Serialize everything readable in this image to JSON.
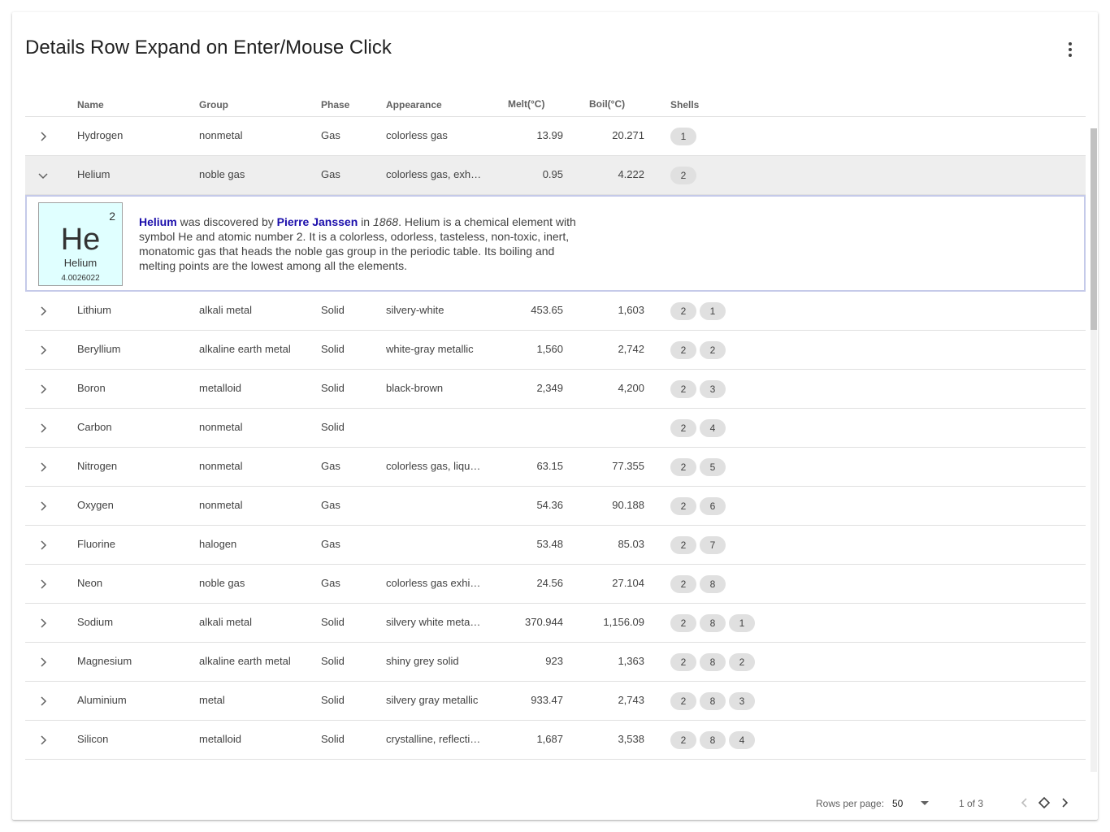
{
  "title": "Details Row Expand on Enter/Mouse Click",
  "icons": {
    "menu": "kebab-menu-icon",
    "expand": "chevron-right-icon",
    "collapse": "chevron-down-icon",
    "prev": "chevron-left-icon",
    "first": "diamond-icon",
    "next": "chevron-right-icon"
  },
  "columns": {
    "name": "Name",
    "group": "Group",
    "phase": "Phase",
    "appearance": "Appearance",
    "melt": "Melt(°C)",
    "boil": "Boil(°C)",
    "shells": "Shells"
  },
  "rows": [
    {
      "name": "Hydrogen",
      "group": "nonmetal",
      "phase": "Gas",
      "appearance": "colorless gas",
      "melt": "13.99",
      "boil": "20.271",
      "shells": [
        "1"
      ]
    },
    {
      "name": "Helium",
      "group": "noble gas",
      "phase": "Gas",
      "appearance": "colorless gas, exhi…",
      "melt": "0.95",
      "boil": "4.222",
      "shells": [
        "2"
      ],
      "expanded": true
    },
    {
      "name": "Lithium",
      "group": "alkali metal",
      "phase": "Solid",
      "appearance": "silvery-white",
      "melt": "453.65",
      "boil": "1,603",
      "shells": [
        "2",
        "1"
      ]
    },
    {
      "name": "Beryllium",
      "group": "alkaline earth metal",
      "phase": "Solid",
      "appearance": "white-gray metallic",
      "melt": "1,560",
      "boil": "2,742",
      "shells": [
        "2",
        "2"
      ]
    },
    {
      "name": "Boron",
      "group": "metalloid",
      "phase": "Solid",
      "appearance": "black-brown",
      "melt": "2,349",
      "boil": "4,200",
      "shells": [
        "2",
        "3"
      ]
    },
    {
      "name": "Carbon",
      "group": "nonmetal",
      "phase": "Solid",
      "appearance": "",
      "melt": "",
      "boil": "",
      "shells": [
        "2",
        "4"
      ]
    },
    {
      "name": "Nitrogen",
      "group": "nonmetal",
      "phase": "Gas",
      "appearance": "colorless gas, liqui…",
      "melt": "63.15",
      "boil": "77.355",
      "shells": [
        "2",
        "5"
      ]
    },
    {
      "name": "Oxygen",
      "group": "nonmetal",
      "phase": "Gas",
      "appearance": "",
      "melt": "54.36",
      "boil": "90.188",
      "shells": [
        "2",
        "6"
      ]
    },
    {
      "name": "Fluorine",
      "group": "halogen",
      "phase": "Gas",
      "appearance": "",
      "melt": "53.48",
      "boil": "85.03",
      "shells": [
        "2",
        "7"
      ]
    },
    {
      "name": "Neon",
      "group": "noble gas",
      "phase": "Gas",
      "appearance": "colorless gas exhi…",
      "melt": "24.56",
      "boil": "27.104",
      "shells": [
        "2",
        "8"
      ]
    },
    {
      "name": "Sodium",
      "group": "alkali metal",
      "phase": "Solid",
      "appearance": "silvery white metal…",
      "melt": "370.944",
      "boil": "1,156.09",
      "shells": [
        "2",
        "8",
        "1"
      ]
    },
    {
      "name": "Magnesium",
      "group": "alkaline earth metal",
      "phase": "Solid",
      "appearance": "shiny grey solid",
      "melt": "923",
      "boil": "1,363",
      "shells": [
        "2",
        "8",
        "2"
      ]
    },
    {
      "name": "Aluminium",
      "group": "metal",
      "phase": "Solid",
      "appearance": "silvery gray metallic",
      "melt": "933.47",
      "boil": "2,743",
      "shells": [
        "2",
        "8",
        "3"
      ]
    },
    {
      "name": "Silicon",
      "group": "metalloid",
      "phase": "Solid",
      "appearance": "crystalline, reflecti…",
      "melt": "1,687",
      "boil": "3,538",
      "shells": [
        "2",
        "8",
        "4"
      ]
    }
  ],
  "detail": {
    "tile": {
      "number": "2",
      "symbol": "He",
      "name": "Helium",
      "mass": "4.0026022",
      "color": "#e0ffff"
    },
    "link_name": "Helium",
    "t1": " was discovered by ",
    "discoverer": "Pierre Janssen",
    "t2": " in ",
    "year": "1868",
    "t3": ". Helium is a chemical element with symbol He and atomic number 2. It is a colorless, odorless, tasteless, non-toxic, inert, monatomic gas that heads the noble gas group in the periodic table. Its boiling and melting points are the lowest among all the elements."
  },
  "pager": {
    "rows_label": "Rows per page:",
    "rows_value": "50",
    "page_text": "1 of 3"
  },
  "colors": {
    "link": "#1a0dab",
    "selected_row": "#eeeeee",
    "detail_border": "#c5cae9",
    "chip": "#e0e0e0"
  }
}
